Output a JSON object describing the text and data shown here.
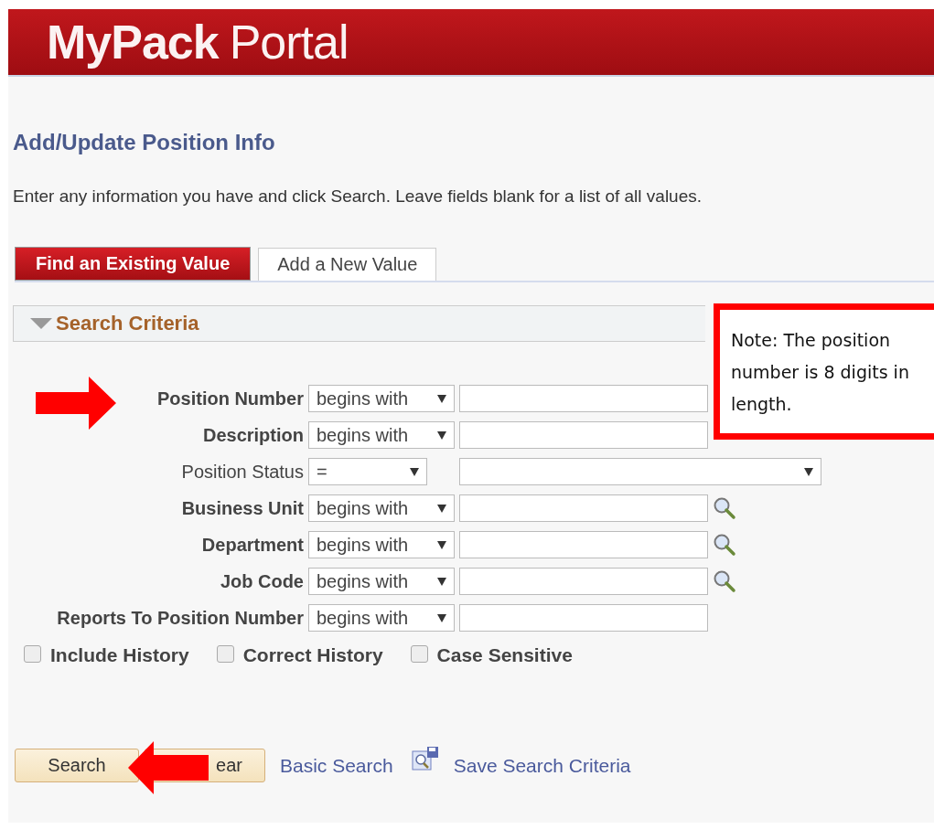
{
  "header": {
    "logo_bold": "MyPack",
    "logo_light": "Portal"
  },
  "page": {
    "title": "Add/Update Position Info",
    "instructions": "Enter any information you have and click Search. Leave fields blank for a list of all values."
  },
  "tabs": [
    {
      "label": "Find an Existing Value",
      "selected": true
    },
    {
      "label": "Add a New Value",
      "selected": false
    }
  ],
  "section": {
    "title": "Search Criteria",
    "expanded": true
  },
  "fields": [
    {
      "label": "Position Number",
      "bold": true,
      "operator": "begins with",
      "kind": "text",
      "lookup": false
    },
    {
      "label": "Description",
      "bold": true,
      "operator": "begins with",
      "kind": "text",
      "lookup": false
    },
    {
      "label": "Position Status",
      "bold": false,
      "operator": "=",
      "kind": "dropdown",
      "lookup": false
    },
    {
      "label": "Business Unit",
      "bold": true,
      "operator": "begins with",
      "kind": "text",
      "lookup": true
    },
    {
      "label": "Department",
      "bold": true,
      "operator": "begins with",
      "kind": "text",
      "lookup": true
    },
    {
      "label": "Job Code",
      "bold": true,
      "operator": "begins with",
      "kind": "text",
      "lookup": true
    },
    {
      "label": "Reports To Position Number",
      "bold": true,
      "operator": "begins with",
      "kind": "text",
      "lookup": false
    }
  ],
  "options": [
    {
      "label": "Include History",
      "checked": false
    },
    {
      "label": "Correct History",
      "checked": false
    },
    {
      "label": "Case Sensitive",
      "checked": false
    }
  ],
  "buttons": [
    {
      "label": "Search"
    },
    {
      "label": "ear"
    }
  ],
  "links": [
    {
      "label": "Basic Search"
    },
    {
      "label": "Save Search Criteria"
    }
  ],
  "note": {
    "text": "Note: The position number is 8 digits in length."
  }
}
